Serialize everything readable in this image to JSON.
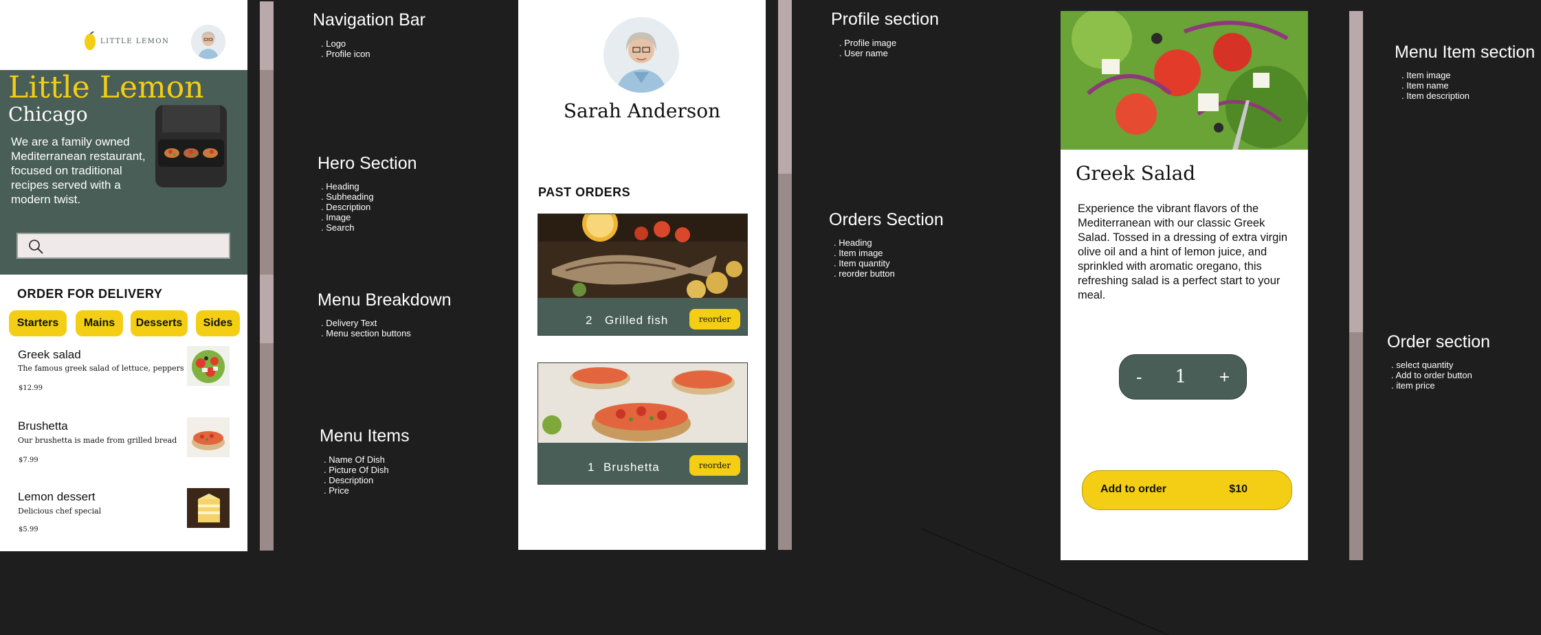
{
  "home": {
    "logo_text": "LITTLE LEMON",
    "hero": {
      "title": "Little Lemon",
      "subtitle": "Chicago",
      "description": "We are a family owned Mediterranean restaurant, focused on traditional recipes served with a modern twist."
    },
    "search": {
      "icon": "search-icon"
    },
    "delivery_heading": "ORDER FOR DELIVERY",
    "categories": [
      "Starters",
      "Mains",
      "Desserts",
      "Sides"
    ],
    "menu_items": [
      {
        "name": "Greek salad",
        "description": "The famous greek salad of lettuce, peppers",
        "price": "$12.99"
      },
      {
        "name": "Brushetta",
        "description": "Our brushetta is made from grilled bread",
        "price": "$7.99"
      },
      {
        "name": "Lemon dessert",
        "description": "Delicious chef special",
        "price": "$5.99"
      }
    ]
  },
  "annotations_left": [
    {
      "title": "Navigation Bar",
      "items": [
        "Logo",
        "Profile icon"
      ]
    },
    {
      "title": "Hero Section",
      "items": [
        "Heading",
        "Subheading",
        "Description",
        "Image",
        "Search"
      ]
    },
    {
      "title": "Menu Breakdown",
      "items": [
        "Delivery Text",
        "Menu section buttons"
      ]
    },
    {
      "title": "Menu Items",
      "items": [
        "Name Of Dish",
        "Picture Of Dish",
        "Description",
        "Price"
      ]
    }
  ],
  "profile": {
    "user_name": "Sarah Anderson",
    "past_orders_heading": "PAST ORDERS",
    "orders": [
      {
        "quantity": "2",
        "name": "Grilled fish",
        "button": "reorder"
      },
      {
        "quantity": "1",
        "name": "Brushetta",
        "button": "reorder"
      }
    ]
  },
  "annotations_middle": [
    {
      "title": "Profile section",
      "items": [
        "Profile image",
        "User name"
      ]
    },
    {
      "title": "Orders Section",
      "items": [
        "Heading",
        "Item image",
        "Item quantity",
        "reorder button"
      ]
    }
  ],
  "item": {
    "name": "Greek Salad",
    "description": "Experience the vibrant flavors of the Mediterranean with our classic Greek Salad. Tossed in a dressing of extra virgin olive oil and a hint of lemon juice, and sprinkled with aromatic oregano, this refreshing salad is a perfect start to your meal.",
    "minus": "-",
    "quantity": "1",
    "plus": "+",
    "add_label": "Add to order",
    "price": "$10"
  },
  "annotations_right": [
    {
      "title": "Menu Item section",
      "items": [
        "Item image",
        "Item name",
        "Item description"
      ]
    },
    {
      "title": "Order section",
      "items": [
        "select quantity",
        "Add to order button",
        "item price"
      ]
    }
  ],
  "colors": {
    "primary_green": "#495e57",
    "primary_yellow": "#f4ce14",
    "canvas": "#1e1e1e"
  }
}
